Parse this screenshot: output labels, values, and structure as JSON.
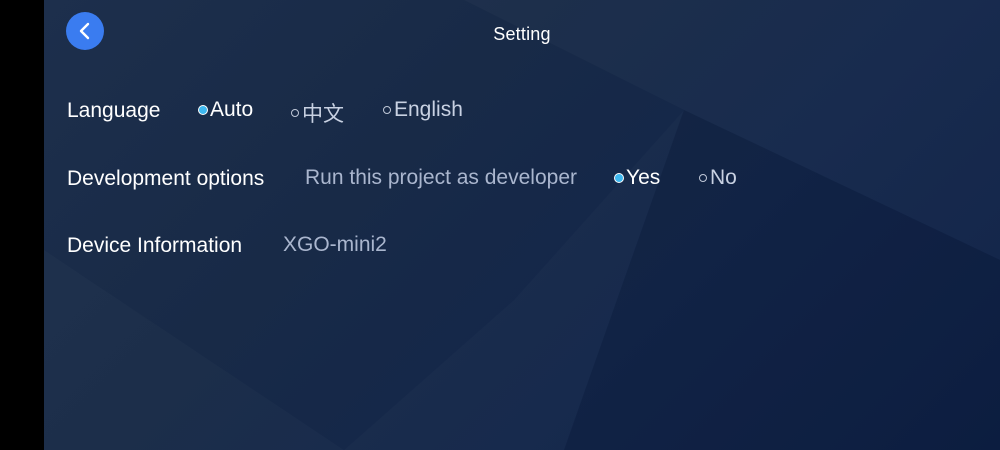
{
  "header": {
    "title": "Setting",
    "back_icon": "chevron-left-icon"
  },
  "colors": {
    "accent": "#3a7cf0",
    "radio_selected": "#3eb8f0",
    "background": "#182a47"
  },
  "language": {
    "label": "Language",
    "options": [
      {
        "label": "Auto",
        "selected": true
      },
      {
        "label": "中文",
        "selected": false
      },
      {
        "label": "English",
        "selected": false
      }
    ]
  },
  "development": {
    "label": "Development options",
    "description": "Run this project as developer",
    "options": [
      {
        "label": "Yes",
        "selected": true
      },
      {
        "label": "No",
        "selected": false
      }
    ]
  },
  "device": {
    "label": "Device Information",
    "value": "XGO-mini2"
  }
}
